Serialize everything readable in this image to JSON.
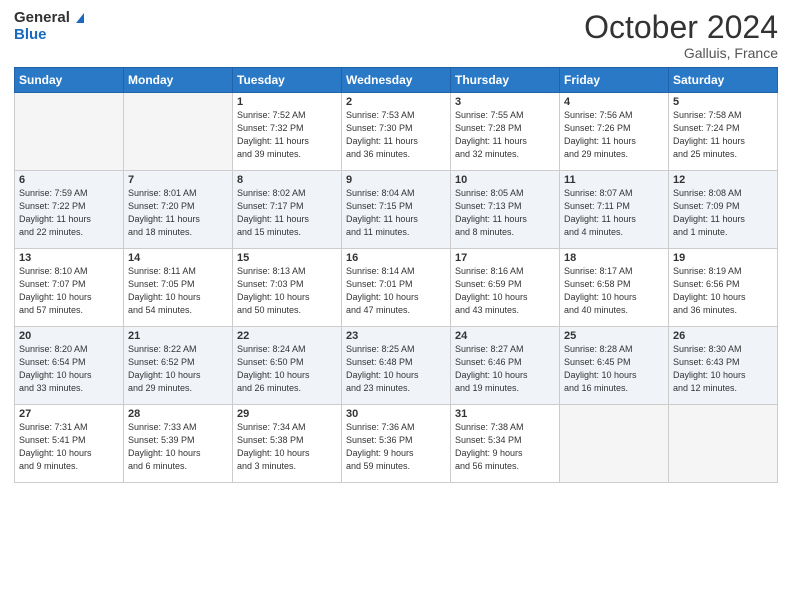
{
  "logo": {
    "line1": "General",
    "line2": "Blue"
  },
  "title": "October 2024",
  "location": "Galluis, France",
  "weekdays": [
    "Sunday",
    "Monday",
    "Tuesday",
    "Wednesday",
    "Thursday",
    "Friday",
    "Saturday"
  ],
  "weeks": [
    [
      {
        "day": "",
        "info": ""
      },
      {
        "day": "",
        "info": ""
      },
      {
        "day": "1",
        "info": "Sunrise: 7:52 AM\nSunset: 7:32 PM\nDaylight: 11 hours\nand 39 minutes."
      },
      {
        "day": "2",
        "info": "Sunrise: 7:53 AM\nSunset: 7:30 PM\nDaylight: 11 hours\nand 36 minutes."
      },
      {
        "day": "3",
        "info": "Sunrise: 7:55 AM\nSunset: 7:28 PM\nDaylight: 11 hours\nand 32 minutes."
      },
      {
        "day": "4",
        "info": "Sunrise: 7:56 AM\nSunset: 7:26 PM\nDaylight: 11 hours\nand 29 minutes."
      },
      {
        "day": "5",
        "info": "Sunrise: 7:58 AM\nSunset: 7:24 PM\nDaylight: 11 hours\nand 25 minutes."
      }
    ],
    [
      {
        "day": "6",
        "info": "Sunrise: 7:59 AM\nSunset: 7:22 PM\nDaylight: 11 hours\nand 22 minutes."
      },
      {
        "day": "7",
        "info": "Sunrise: 8:01 AM\nSunset: 7:20 PM\nDaylight: 11 hours\nand 18 minutes."
      },
      {
        "day": "8",
        "info": "Sunrise: 8:02 AM\nSunset: 7:17 PM\nDaylight: 11 hours\nand 15 minutes."
      },
      {
        "day": "9",
        "info": "Sunrise: 8:04 AM\nSunset: 7:15 PM\nDaylight: 11 hours\nand 11 minutes."
      },
      {
        "day": "10",
        "info": "Sunrise: 8:05 AM\nSunset: 7:13 PM\nDaylight: 11 hours\nand 8 minutes."
      },
      {
        "day": "11",
        "info": "Sunrise: 8:07 AM\nSunset: 7:11 PM\nDaylight: 11 hours\nand 4 minutes."
      },
      {
        "day": "12",
        "info": "Sunrise: 8:08 AM\nSunset: 7:09 PM\nDaylight: 11 hours\nand 1 minute."
      }
    ],
    [
      {
        "day": "13",
        "info": "Sunrise: 8:10 AM\nSunset: 7:07 PM\nDaylight: 10 hours\nand 57 minutes."
      },
      {
        "day": "14",
        "info": "Sunrise: 8:11 AM\nSunset: 7:05 PM\nDaylight: 10 hours\nand 54 minutes."
      },
      {
        "day": "15",
        "info": "Sunrise: 8:13 AM\nSunset: 7:03 PM\nDaylight: 10 hours\nand 50 minutes."
      },
      {
        "day": "16",
        "info": "Sunrise: 8:14 AM\nSunset: 7:01 PM\nDaylight: 10 hours\nand 47 minutes."
      },
      {
        "day": "17",
        "info": "Sunrise: 8:16 AM\nSunset: 6:59 PM\nDaylight: 10 hours\nand 43 minutes."
      },
      {
        "day": "18",
        "info": "Sunrise: 8:17 AM\nSunset: 6:58 PM\nDaylight: 10 hours\nand 40 minutes."
      },
      {
        "day": "19",
        "info": "Sunrise: 8:19 AM\nSunset: 6:56 PM\nDaylight: 10 hours\nand 36 minutes."
      }
    ],
    [
      {
        "day": "20",
        "info": "Sunrise: 8:20 AM\nSunset: 6:54 PM\nDaylight: 10 hours\nand 33 minutes."
      },
      {
        "day": "21",
        "info": "Sunrise: 8:22 AM\nSunset: 6:52 PM\nDaylight: 10 hours\nand 29 minutes."
      },
      {
        "day": "22",
        "info": "Sunrise: 8:24 AM\nSunset: 6:50 PM\nDaylight: 10 hours\nand 26 minutes."
      },
      {
        "day": "23",
        "info": "Sunrise: 8:25 AM\nSunset: 6:48 PM\nDaylight: 10 hours\nand 23 minutes."
      },
      {
        "day": "24",
        "info": "Sunrise: 8:27 AM\nSunset: 6:46 PM\nDaylight: 10 hours\nand 19 minutes."
      },
      {
        "day": "25",
        "info": "Sunrise: 8:28 AM\nSunset: 6:45 PM\nDaylight: 10 hours\nand 16 minutes."
      },
      {
        "day": "26",
        "info": "Sunrise: 8:30 AM\nSunset: 6:43 PM\nDaylight: 10 hours\nand 12 minutes."
      }
    ],
    [
      {
        "day": "27",
        "info": "Sunrise: 7:31 AM\nSunset: 5:41 PM\nDaylight: 10 hours\nand 9 minutes."
      },
      {
        "day": "28",
        "info": "Sunrise: 7:33 AM\nSunset: 5:39 PM\nDaylight: 10 hours\nand 6 minutes."
      },
      {
        "day": "29",
        "info": "Sunrise: 7:34 AM\nSunset: 5:38 PM\nDaylight: 10 hours\nand 3 minutes."
      },
      {
        "day": "30",
        "info": "Sunrise: 7:36 AM\nSunset: 5:36 PM\nDaylight: 9 hours\nand 59 minutes."
      },
      {
        "day": "31",
        "info": "Sunrise: 7:38 AM\nSunset: 5:34 PM\nDaylight: 9 hours\nand 56 minutes."
      },
      {
        "day": "",
        "info": ""
      },
      {
        "day": "",
        "info": ""
      }
    ]
  ]
}
